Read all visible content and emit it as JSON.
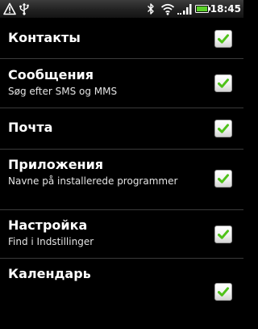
{
  "status_bar": {
    "time": "18:45",
    "icons": [
      "warning-icon",
      "usb-icon",
      "bluetooth-icon",
      "wifi-icon",
      "signal-icon",
      "battery-icon"
    ]
  },
  "colors": {
    "background": "#000000",
    "check_green": "#4fc21a",
    "divider": "#3a3a3a"
  },
  "settings": {
    "items": [
      {
        "title": "Контакты",
        "subtitle": "",
        "checked": true
      },
      {
        "title": "Сообщения",
        "subtitle": "Søg efter SMS og MMS",
        "checked": true
      },
      {
        "title": "Почта",
        "subtitle": "",
        "checked": true
      },
      {
        "title": "Приложения",
        "subtitle": "Navne på installerede programmer",
        "checked": true
      },
      {
        "title": "Настройка",
        "subtitle": "Find i Indstillinger",
        "checked": true
      },
      {
        "title": "Календарь",
        "subtitle": "",
        "checked": true
      }
    ]
  }
}
